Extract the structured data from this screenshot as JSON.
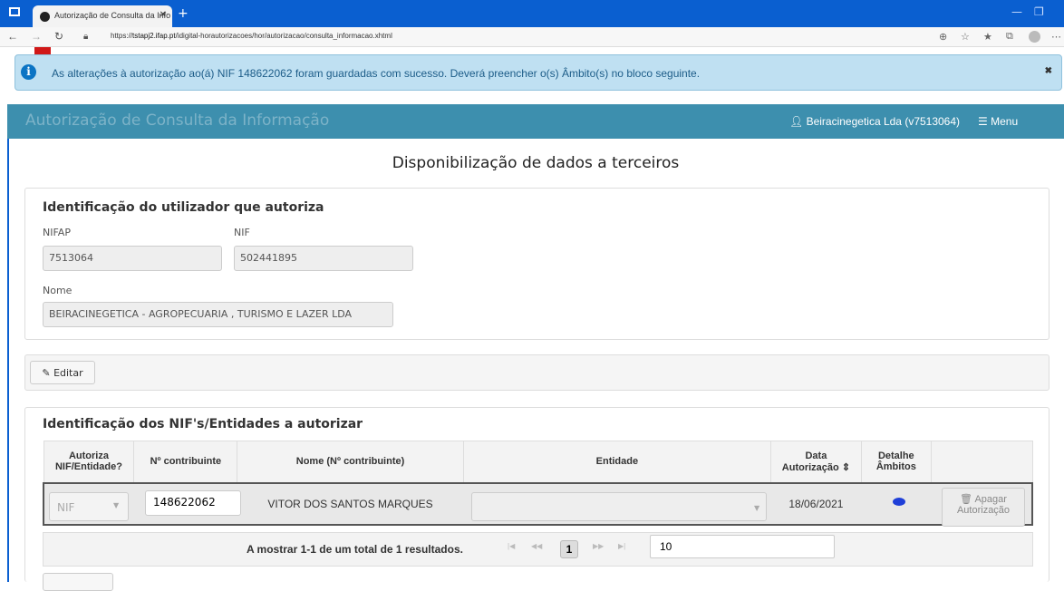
{
  "browser": {
    "tab_title": "Autorização de Consulta da Info",
    "url_prefix": "https://",
    "url_host": "tstapj2.ifap.pt",
    "url_path": "/idigital-horautorizacoes/hor/autorizacao/consulta_informacao.xhtml"
  },
  "alert": {
    "message": "As alterações à autorização ao(á) NIF 148622062 foram guardadas com sucesso. Deverá preencher o(s) Âmbito(s) no bloco seguinte.",
    "close_label": "✖"
  },
  "navbar": {
    "brand": "Autorização de Consulta da Informação",
    "user": "Beiracinegetica Lda (v7513064)",
    "menu_label": "Menu"
  },
  "page_title": "Disponibilização de dados a terceiros",
  "user_section": {
    "title": "Identificação do utilizador que autoriza",
    "nifap_label": "NIFAP",
    "nifap_value": "7513064",
    "nif_label": "NIF",
    "nif_value": "502441895",
    "nome_label": "Nome",
    "nome_value": "BEIRACINEGETICA - AGROPECUARIA , TURISMO E LAZER LDA"
  },
  "edit_button": "Editar",
  "entities_section": {
    "title": "Identificação dos NIF's/Entidades a autorizar",
    "headers": {
      "autoriza_1": "Autoriza",
      "autoriza_2": "NIF/Entidade?",
      "contribuinte": "Nº contribuinte",
      "nome": "Nome (Nº contribuinte)",
      "entidade": "Entidade",
      "data_1": "Data",
      "data_2": "Autorização",
      "detalhe_1": "Detalhe",
      "detalhe_2": "Âmbitos"
    },
    "row": {
      "autoriza": "NIF",
      "contribuinte": "148622062",
      "nome": "VITOR DOS SANTOS MARQUES",
      "entidade": "",
      "data": "18/06/2021",
      "delete_1": "Apagar",
      "delete_2": "Autorização"
    },
    "pager": {
      "summary": "A mostrar 1-1 de um total de 1 resultados.",
      "current_page": "1",
      "page_size": "10"
    }
  }
}
